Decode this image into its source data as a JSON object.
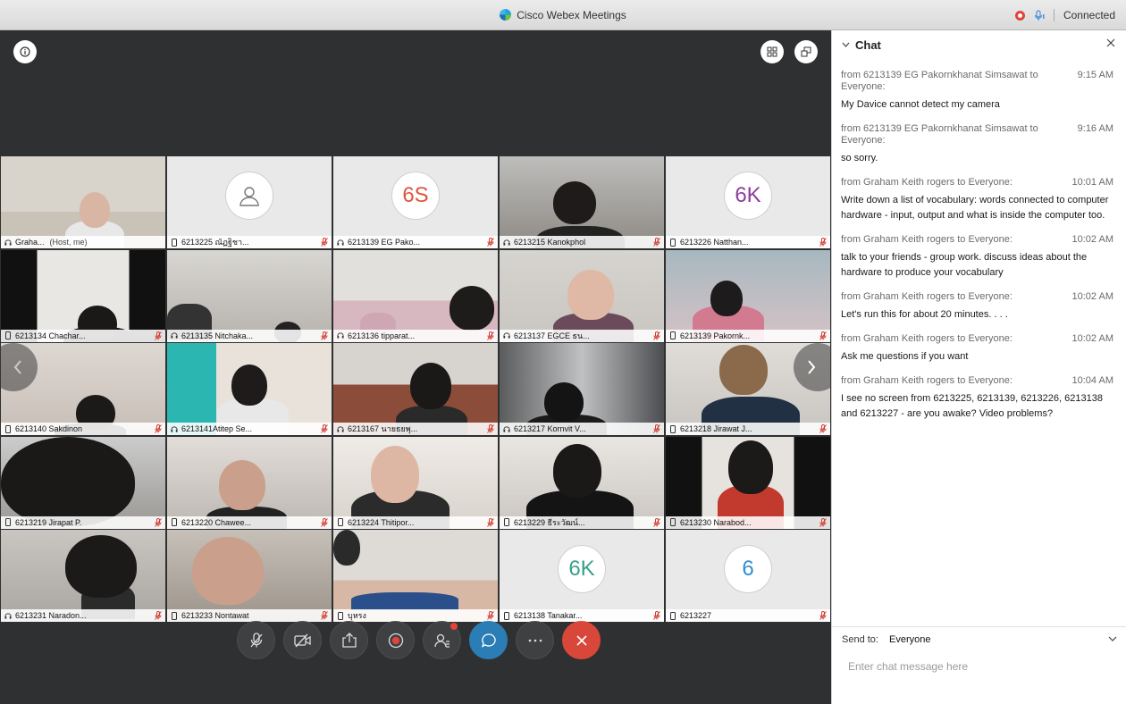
{
  "window": {
    "title": "Cisco Webex Meetings",
    "status": "Connected"
  },
  "participants": [
    {
      "name": "Graha...",
      "note": "(Host, me)",
      "avatar": "",
      "avatar_color": "",
      "muted": false
    },
    {
      "name": "6213225 ณัฏฐิชา...",
      "note": "",
      "avatar": "person",
      "avatar_color": "#888888",
      "muted": true
    },
    {
      "name": "6213139 EG Pako...",
      "note": "",
      "avatar": "6S",
      "avatar_color": "#e0553f",
      "muted": true
    },
    {
      "name": "6213215 Kanokphol",
      "note": "",
      "avatar": "",
      "avatar_color": "",
      "muted": true
    },
    {
      "name": "6213226 Natthan...",
      "note": "",
      "avatar": "6K",
      "avatar_color": "#8b3f9e",
      "muted": true
    },
    {
      "name": "6213134 Chachar...",
      "note": "",
      "avatar": "",
      "avatar_color": "",
      "muted": true
    },
    {
      "name": "6213135 Nitchaka...",
      "note": "",
      "avatar": "",
      "avatar_color": "",
      "muted": true
    },
    {
      "name": "6213136 tipparat...",
      "note": "",
      "avatar": "",
      "avatar_color": "",
      "muted": true
    },
    {
      "name": "6213137 EGCE ธน...",
      "note": "",
      "avatar": "",
      "avatar_color": "",
      "muted": true
    },
    {
      "name": "6213139 Pakornk...",
      "note": "",
      "avatar": "",
      "avatar_color": "",
      "muted": true
    },
    {
      "name": "6213140 Sakdinon",
      "note": "",
      "avatar": "",
      "avatar_color": "",
      "muted": true
    },
    {
      "name": "6213141Atitep Se...",
      "note": "",
      "avatar": "",
      "avatar_color": "",
      "muted": true
    },
    {
      "name": "6213167 นายธยพุ...",
      "note": "",
      "avatar": "",
      "avatar_color": "",
      "muted": true
    },
    {
      "name": "6213217 Kornvit V...",
      "note": "",
      "avatar": "",
      "avatar_color": "",
      "muted": true
    },
    {
      "name": "6213218 Jirawat J...",
      "note": "",
      "avatar": "",
      "avatar_color": "",
      "muted": true
    },
    {
      "name": "6213219 Jirapat P.",
      "note": "",
      "avatar": "",
      "avatar_color": "",
      "muted": true
    },
    {
      "name": "6213220 Chawee...",
      "note": "",
      "avatar": "",
      "avatar_color": "",
      "muted": true
    },
    {
      "name": "6213224 Thitipor...",
      "note": "",
      "avatar": "",
      "avatar_color": "",
      "muted": true
    },
    {
      "name": "6213229 ธีระวัฒน์...",
      "note": "",
      "avatar": "",
      "avatar_color": "",
      "muted": true
    },
    {
      "name": "6213230 Narabod...",
      "note": "",
      "avatar": "",
      "avatar_color": "",
      "muted": true
    },
    {
      "name": "6213231 Naradon...",
      "note": "",
      "avatar": "",
      "avatar_color": "",
      "muted": true
    },
    {
      "name": "6213233 Nontawat",
      "note": "",
      "avatar": "",
      "avatar_color": "",
      "muted": true
    },
    {
      "name": "บุหรง",
      "note": "",
      "avatar": "",
      "avatar_color": "",
      "muted": true
    },
    {
      "name": "6213138 Tanakar...",
      "note": "",
      "avatar": "6K",
      "avatar_color": "#3aa08a",
      "muted": true
    },
    {
      "name": "6213227",
      "note": "",
      "avatar": "6",
      "avatar_color": "#2f8fd0",
      "muted": true
    }
  ],
  "chat": {
    "title": "Chat",
    "send_to_label": "Send to:",
    "send_to_value": "Everyone",
    "input_placeholder": "Enter chat message here",
    "messages": [
      {
        "from": "from 6213139 EG Pakornkhanat Simsawat to Everyone:",
        "time": "9:15 AM",
        "text": "My Davice cannot detect my camera"
      },
      {
        "from": "from 6213139 EG Pakornkhanat Simsawat to Everyone:",
        "time": "9:16 AM",
        "text": "so sorry."
      },
      {
        "from": "from Graham Keith rogers to Everyone:",
        "time": "10:01  AM",
        "text": "Write down a list of vocabulary: words connected to computer hardware - input, output and what is inside the computer too."
      },
      {
        "from": "from Graham Keith rogers to Everyone:",
        "time": "10:02  AM",
        "text": "talk to your friends - group work.  discuss ideas about the hardware to produce your vocabulary"
      },
      {
        "from": "from Graham Keith rogers to Everyone:",
        "time": "10:02  AM",
        "text": "Let's run this for about 20 minutes. . . ."
      },
      {
        "from": "from Graham Keith rogers to Everyone:",
        "time": "10:02  AM",
        "text": "Ask me questions if you want"
      },
      {
        "from": "from Graham Keith rogers to Everyone:",
        "time": "10:04  AM",
        "text": "I see no screen from 6213225, 6213139, 6213226, 6213138 and 6213227 - are you awake?  Video problems?"
      }
    ]
  },
  "icons": {
    "info": "info-icon",
    "layout": "grid-layout-icon",
    "pip": "minimize-window-icon",
    "mute": "microphone-muted-icon",
    "video": "camera-off-icon",
    "share": "share-icon",
    "record": "record-icon",
    "participants": "participants-icon",
    "chat": "chat-icon",
    "more": "more-icon",
    "leave": "leave-icon"
  },
  "colors": {
    "accent": "#2b7db5",
    "leave": "#d9473a",
    "recording": "#e0443a"
  }
}
